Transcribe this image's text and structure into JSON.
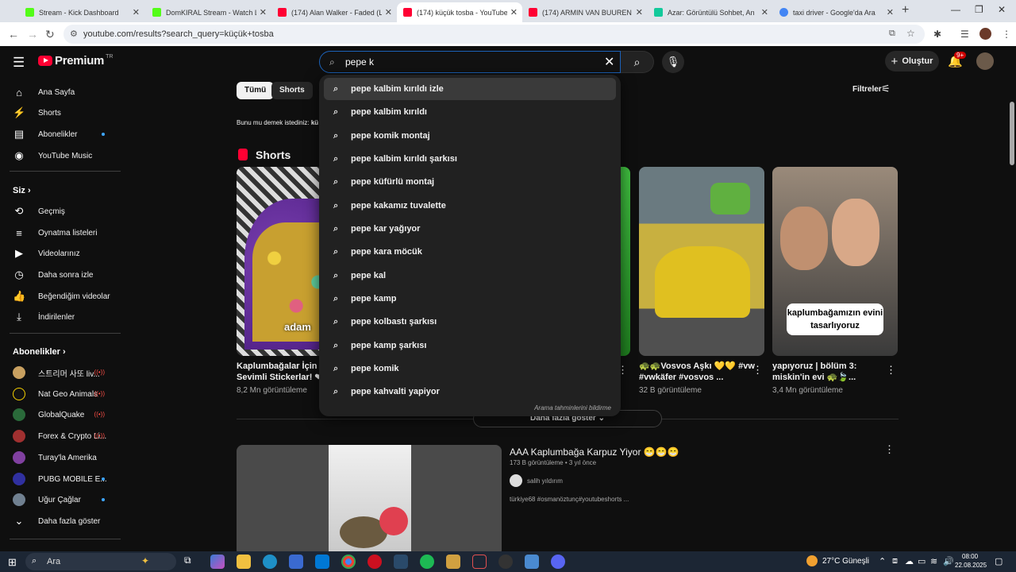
{
  "browser": {
    "tabs": [
      {
        "label": "Stream - Kick Dashboard",
        "fav": "#53fc18"
      },
      {
        "label": "DomKIRAL Stream - Watch Live",
        "fav": "#53fc18"
      },
      {
        "label": "(174) Alan Walker - Faded (Lyric",
        "fav": "#ff0033"
      },
      {
        "label": "(174) küçük tosba - YouTube",
        "fav": "#ff0033"
      },
      {
        "label": "(174) ARMIN VAN BUUREN x V",
        "fav": "#ff0033"
      },
      {
        "label": "Azar: Görüntülü Sohbet, An",
        "fav": "#12c99b"
      },
      {
        "label": "taxi driver - Google'da Ara",
        "fav": "#4285f4"
      }
    ],
    "close_glyph": "✕",
    "new_tab_glyph": "+",
    "url": "youtube.com/results?search_query=küçük+tosba"
  },
  "yt": {
    "logo": "Premium",
    "logo_region": "TR",
    "search": {
      "value": "pepe k"
    },
    "create_label": "Oluştur",
    "notif_badge": "9+",
    "sidebar": {
      "main": [
        {
          "label": "Ana Sayfa",
          "icon": "⌂"
        },
        {
          "label": "Shorts",
          "icon": "⚡"
        },
        {
          "label": "Abonelikler",
          "icon": "▤"
        },
        {
          "label": "YouTube Music",
          "icon": "◉"
        }
      ],
      "you_header": "Siz",
      "you": [
        {
          "label": "Geçmiş",
          "icon": "⟲"
        },
        {
          "label": "Oynatma listeleri",
          "icon": "≡"
        },
        {
          "label": "Videolarınız",
          "icon": "▶"
        },
        {
          "label": "Daha sonra izle",
          "icon": "◷"
        },
        {
          "label": "Beğendiğim videolar",
          "icon": "👍"
        },
        {
          "label": "İndirilenler",
          "icon": "⤓"
        }
      ],
      "subs_header": "Abonelikler",
      "subs": [
        {
          "label": "스트리머 사또 liv...",
          "color": "#c8a060"
        },
        {
          "label": "Nat Geo Animals",
          "color": "#111111"
        },
        {
          "label": "GlobalQuake",
          "color": "#2a6a3a"
        },
        {
          "label": "Forex & Crypto Li...",
          "color": "#a03030"
        },
        {
          "label": "Turay'la Amerika",
          "color": "#8040a0"
        },
        {
          "label": "PUBG MOBILE E...",
          "color": "#3030a0"
        },
        {
          "label": "Uğur Çağlar",
          "color": "#708090"
        }
      ],
      "show_more": "Daha fazla göster"
    },
    "chips": [
      "Tümü",
      "Shorts"
    ],
    "filters_label": "Filtreler",
    "did_you_mean_prefix": "Bunu mu demek istediniz:",
    "did_you_mean_term": "kü",
    "shorts_title": "Shorts",
    "shorts": [
      {
        "title": "Kaplumbağalar İçin Sü Sevimli Stickerlar! ❤",
        "views": "8,2 Mn görüntüleme",
        "overlay": "adam"
      },
      {
        "title": "🐢🐢Vosvos Aşkı 💛💛 #vw #vwkäfer #vosvos ...",
        "views": "32 B görüntüleme",
        "overlay": ""
      },
      {
        "title": "yapıyoruz | bölüm 3: miskin'in evi 🐢🍃...",
        "views": "3,4 Mn görüntüleme",
        "overlay": "kaplumbağamızın evini tasarlıyoruz"
      }
    ],
    "show_more_btn": "Daha fazla göster",
    "video": {
      "title": "AAA Kaplumbağa Karpuz Yiyor 😁😁😁",
      "meta": "173 B görüntüleme • 3 yıl önce",
      "channel": "salih yıldırım",
      "desc": "türkiye68 #osmanöztunç#youtubeshorts ..."
    },
    "suggestions": [
      "pepe kalbim kırıldı izle",
      "pepe kalbim kırıldı",
      "pepe komik montaj",
      "pepe kalbim kırıldı şarkısı",
      "pepe küfürlü montaj",
      "pepe kakamız tuvalette",
      "pepe kar yağıyor",
      "pepe kara möcük",
      "pepe kal",
      "pepe kamp",
      "pepe kolbastı şarkısı",
      "pepe kamp şarkısı",
      "pepe komik",
      "pepe kahvalti yapiyor"
    ],
    "suggestions_report": "Arama tahminlerini bildirme"
  },
  "taskbar": {
    "search_label": "Ara",
    "weather": "27°C  Güneşli",
    "time": "08:00",
    "date": "22.08.2025"
  }
}
